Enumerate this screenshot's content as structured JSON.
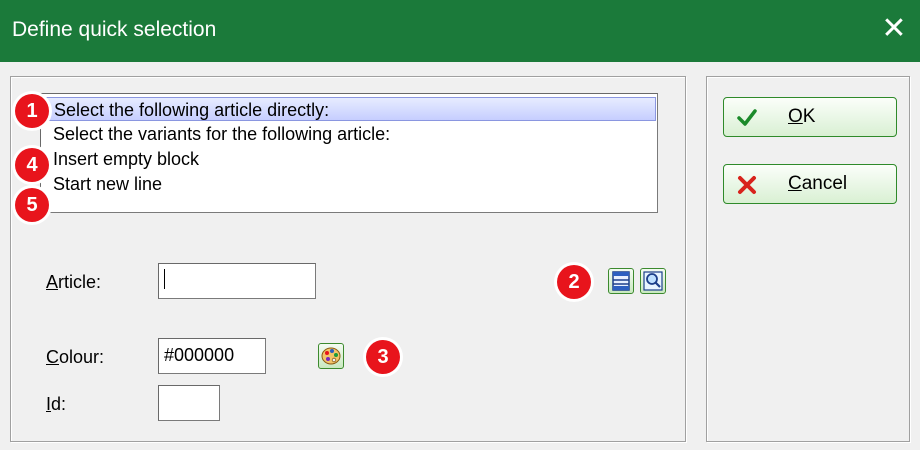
{
  "window": {
    "title": "Define quick selection",
    "close_glyph": "✕"
  },
  "list": {
    "items": [
      {
        "label": "Select the following article directly:",
        "selected": true
      },
      {
        "label": "Select the variants for the following article:",
        "selected": false
      },
      {
        "label": "Insert empty block",
        "selected": false
      },
      {
        "label": "Start new line",
        "selected": false
      }
    ]
  },
  "markers": [
    "1",
    "4",
    "5",
    "2",
    "3"
  ],
  "article": {
    "label_accel": "A",
    "label_rest": "rticle:",
    "value": ""
  },
  "colour": {
    "label_accel": "C",
    "label_rest": "olour:",
    "value": "#000000"
  },
  "id_field": {
    "label_accel": "I",
    "label_rest": "d:",
    "value": ""
  },
  "buttons": {
    "ok": {
      "accel": "O",
      "rest": "K",
      "icon": "checkmark-icon"
    },
    "cancel": {
      "accel": "C",
      "rest": "ancel",
      "icon": "cross-icon"
    }
  },
  "icons": {
    "article_list": "list-icon",
    "article_search": "search-icon",
    "colour_picker": "palette-icon"
  },
  "colors": {
    "title_bar": "#1b7a3a",
    "selection": "#c6ceff",
    "marker": "#e8141c",
    "button_border": "#2f8a2a"
  }
}
